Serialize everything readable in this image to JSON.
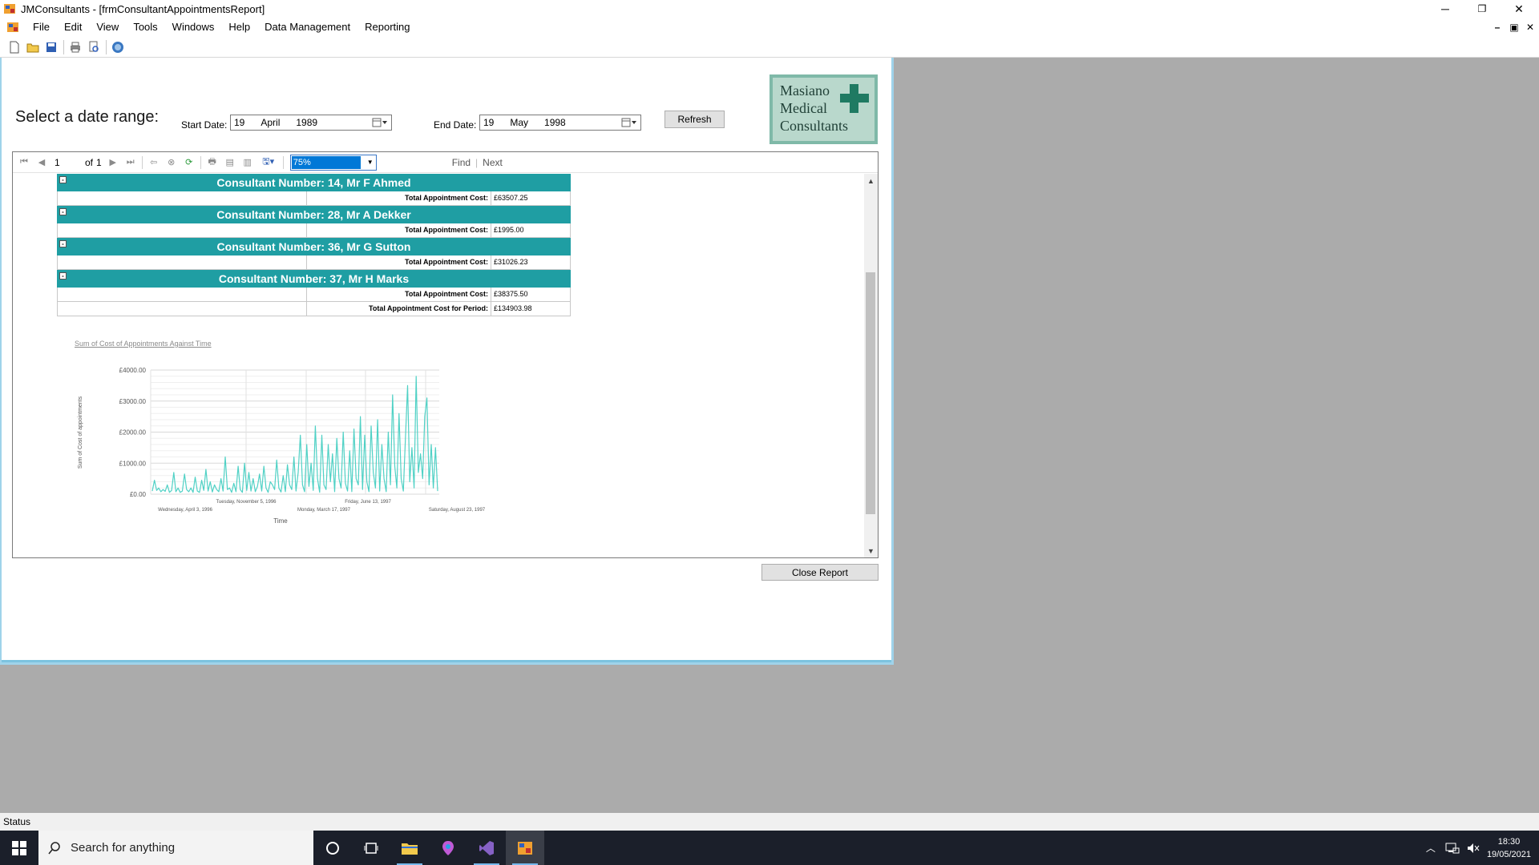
{
  "window": {
    "title": "JMConsultants - [frmConsultantAppointmentsReport]",
    "controls": [
      "─",
      "❐",
      "✕"
    ],
    "mdi_controls": [
      "–",
      "▣",
      "✕"
    ]
  },
  "menu": {
    "items": [
      "File",
      "Edit",
      "View",
      "Tools",
      "Windows",
      "Help",
      "Data Management",
      "Reporting"
    ]
  },
  "toolbar": {
    "icons": [
      "new-icon",
      "open-icon",
      "save-icon",
      "print-icon",
      "print-preview-icon",
      "help-icon"
    ]
  },
  "form": {
    "heading": "Select a date range:",
    "start_label": "Start Date:",
    "start_date": {
      "day": "19",
      "month": "April",
      "year": "1989"
    },
    "end_label": "End Date:",
    "end_date": {
      "day": "19",
      "month": "May",
      "year": "1998"
    },
    "refresh_label": "Refresh",
    "close_label": "Close Report",
    "logo_lines": [
      "Masiano",
      "Medical",
      "Consultants"
    ]
  },
  "viewer": {
    "page_current": "1",
    "page_of": "of",
    "page_total": "1",
    "zoom": "75%",
    "find_label": "Find",
    "next_label": "Next",
    "separator": "|"
  },
  "report": {
    "groups": [
      {
        "header": "Consultant Number: 14, Mr F Ahmed",
        "label": "Total Appointment Cost:",
        "value": "£63507.25"
      },
      {
        "header": "Consultant Number: 28, Mr A Dekker",
        "label": "Total Appointment Cost:",
        "value": "£1995.00"
      },
      {
        "header": "Consultant Number: 36, Mr G Sutton",
        "label": "Total Appointment Cost:",
        "value": "£31026.23"
      },
      {
        "header": "Consultant Number: 37, Mr H Marks",
        "label": "Total Appointment Cost:",
        "value": "£38375.50"
      }
    ],
    "grand_label": "Total Appointment Cost for Period:",
    "grand_value": "£134903.98"
  },
  "chart_data": {
    "type": "line",
    "title": "Sum of Cost of Appointments Against Time",
    "xlabel": "Time",
    "ylabel": "Sum of Cost of appointments",
    "ylim": [
      0,
      4000
    ],
    "yticks": [
      "£4000.00",
      "£3000.00",
      "£2000.00",
      "£1000.00",
      "£0.00"
    ],
    "xticks_lower": [
      "Wednesday, April 3, 1996",
      "Monday, March 17, 1997",
      "Saturday, August 23, 1997"
    ],
    "xticks_upper": [
      "Tuesday, November 5, 1996",
      "Friday, June 13, 1997"
    ],
    "grid": true,
    "color": "#4fd1c5",
    "series": [
      {
        "values": [
          100,
          450,
          120,
          200,
          80,
          150,
          90,
          300,
          60,
          120,
          700,
          80,
          200,
          60,
          100,
          650,
          150,
          80,
          200,
          60,
          550,
          100,
          60,
          450,
          120,
          800,
          100,
          400,
          70,
          300,
          150,
          80,
          500,
          100,
          1200,
          150,
          200,
          60,
          350,
          80,
          900,
          150,
          60,
          1000,
          120,
          700,
          100,
          500,
          80,
          250,
          650,
          100,
          900,
          200,
          60,
          400,
          300,
          150,
          1100,
          200,
          70,
          600,
          80,
          950,
          300,
          150,
          1200,
          100,
          700,
          1900,
          300,
          80,
          1600,
          250,
          1000,
          120,
          2200,
          500,
          60,
          1900,
          300,
          150,
          1600,
          400,
          1300,
          80,
          1800,
          500,
          200,
          2000,
          350,
          100,
          1400,
          80,
          2100,
          500,
          300,
          2500,
          150,
          1900,
          400,
          80,
          2200,
          700,
          200,
          2400,
          100,
          1600,
          500,
          80,
          2000,
          300,
          3200,
          900,
          200,
          2600,
          500,
          100,
          1800,
          3500,
          400,
          1500,
          200,
          3800,
          700,
          1300,
          500,
          2500,
          3100,
          300,
          1600,
          200,
          1500,
          100
        ]
      }
    ]
  },
  "statusbar": {
    "text": "Status"
  },
  "taskbar": {
    "search_placeholder": "Search for anything",
    "time": "18:30",
    "date": "19/05/2021"
  }
}
